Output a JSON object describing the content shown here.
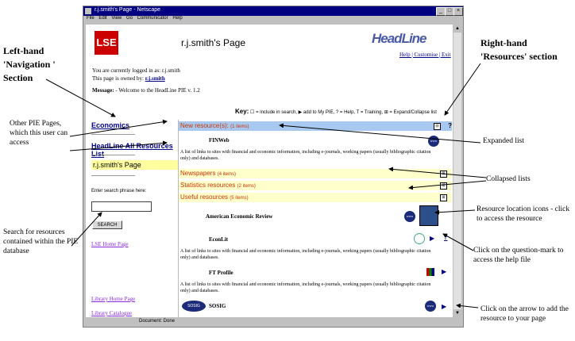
{
  "window": {
    "title": "r.j.smith's Page - Netscape",
    "menu": [
      "File",
      "Edit",
      "View",
      "Go",
      "Communicator",
      "Help"
    ],
    "status": "Document: Done"
  },
  "header": {
    "logo": "LSE",
    "title": "r.j.smith's Page",
    "brand": "HeadLine",
    "links": "Help | Customise | Exit"
  },
  "info": {
    "logged_in": "You are currently logged in as: r.j.smith",
    "owned_by_prefix": "This page is owned by:",
    "owner": "r.j.smith",
    "message_label": "Message:",
    "message_text": "- Welcome to the HeadLine PIE v. 1.2"
  },
  "key": {
    "label": "Key:",
    "text": "= include in search, ▶ add to My PIE, ? = Help, T = Training, ⊞ = Expand/Collapse list"
  },
  "nav": {
    "link1": "Economics",
    "link2": "HeadLine All Resources List",
    "current": "r.j.smith's Page",
    "search_label": "Enter search phrase here:",
    "search_value": "",
    "search_button": "SEARCH",
    "lse_home": "LSE Home Page",
    "library_home": "Library Home Page",
    "library_catalogue": "Library Catalogue"
  },
  "resources": {
    "new_title": "New resource(s):",
    "new_count": "(1 items)",
    "finweb": "FINWeb",
    "desc1": "A list of links to sites with financial and economic information, including e-journals, working papers (usually bibliographic citation only) and databases.",
    "newspapers": "Newspapers",
    "newspapers_count": "(4 items)",
    "statistics": "Statistics resources",
    "statistics_count": "(2 items)",
    "useful": "Useful resources",
    "useful_count": "(5 items)",
    "aer": "American Economic Review",
    "econlit": "EconLit",
    "desc2": "A list of links to sites with financial and economic information, including e-journals, working papers (usually bibliographic citation only) and databases.",
    "ftprofile": "FT Profile",
    "desc3": "A list of links to sites with financial and economic information, including e-journals, working papers (usually bibliographic citation only) and databases.",
    "sosig": "SOSIG",
    "sosig_logo": "SOSIG"
  },
  "annotations": {
    "left_hand": "Left-hand 'Navigation ' Section",
    "right_hand": "Right-hand 'Resources' section",
    "other_pie": "Other PIE Pages, which this user can access",
    "search_for": "Search for resources contained within the PIE database",
    "expanded": "Expanded list",
    "collapsed": "Collapsed lists",
    "location_icons": "Resource location icons - click to access the resource",
    "question_mark": "Click on the question-mark to access the help file",
    "arrow_add": "Click on the arrow to add the resource to your page"
  }
}
